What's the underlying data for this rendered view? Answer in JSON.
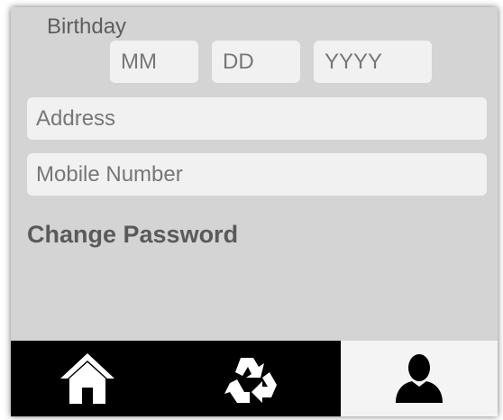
{
  "form": {
    "birthday_label": "Birthday",
    "birthday_fields": {
      "month_placeholder": "MM",
      "day_placeholder": "DD",
      "year_placeholder": "YYYY"
    },
    "address_placeholder": "Address",
    "mobile_placeholder": "Mobile Number",
    "change_password_label": "Change Password"
  },
  "bottom_nav": {
    "items": [
      {
        "icon": "home-icon",
        "active": false
      },
      {
        "icon": "recycle-icon",
        "active": false
      },
      {
        "icon": "profile-icon",
        "active": true
      }
    ]
  },
  "colors": {
    "background": "#d4d4d4",
    "field_background": "#f1f1f1",
    "nav_background": "#000000",
    "nav_active_background": "#f4f4f4",
    "text_muted": "#777777",
    "text_label": "#5a5a5a"
  }
}
